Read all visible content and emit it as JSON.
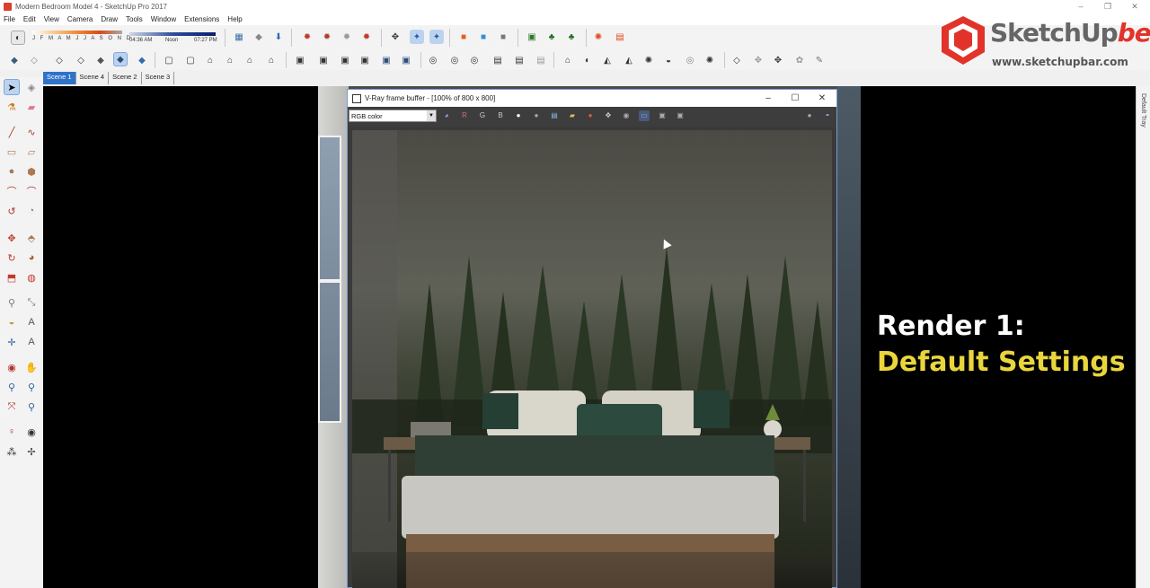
{
  "window": {
    "title": "Modern Bedroom Model 4 - SketchUp Pro 2017",
    "controls": [
      "–",
      "❐",
      "✕"
    ]
  },
  "menu": [
    "File",
    "Edit",
    "View",
    "Camera",
    "Draw",
    "Tools",
    "Window",
    "Extensions",
    "Help"
  ],
  "shadow": {
    "months": "J F M A M J J A S O N D",
    "time_start": "04:36 AM",
    "time_mid": "Noon",
    "time_end": "07:27 PM"
  },
  "scenes": [
    {
      "label": "Scene 1",
      "active": true
    },
    {
      "label": "Scene 4",
      "active": false
    },
    {
      "label": "Scene 2",
      "active": false
    },
    {
      "label": "Scene 3",
      "active": false
    }
  ],
  "right_tray": "Default Tray",
  "vfb": {
    "title": "V-Ray frame buffer - [100% of 800 x 800]",
    "channel": "RGB color",
    "buttons": [
      "R",
      "G",
      "B"
    ],
    "controls": [
      "–",
      "☐",
      "✕"
    ]
  },
  "overlay": {
    "title": "Render 1:",
    "subtitle": "Default Settings"
  },
  "logo": {
    "name": "SketchUp",
    "suffix": "be",
    "url": "www.sketchupbar.com"
  },
  "colors": {
    "accent_yellow": "#e9d63c",
    "scene_active": "#2f73c9",
    "logo_red": "#e2332b"
  }
}
